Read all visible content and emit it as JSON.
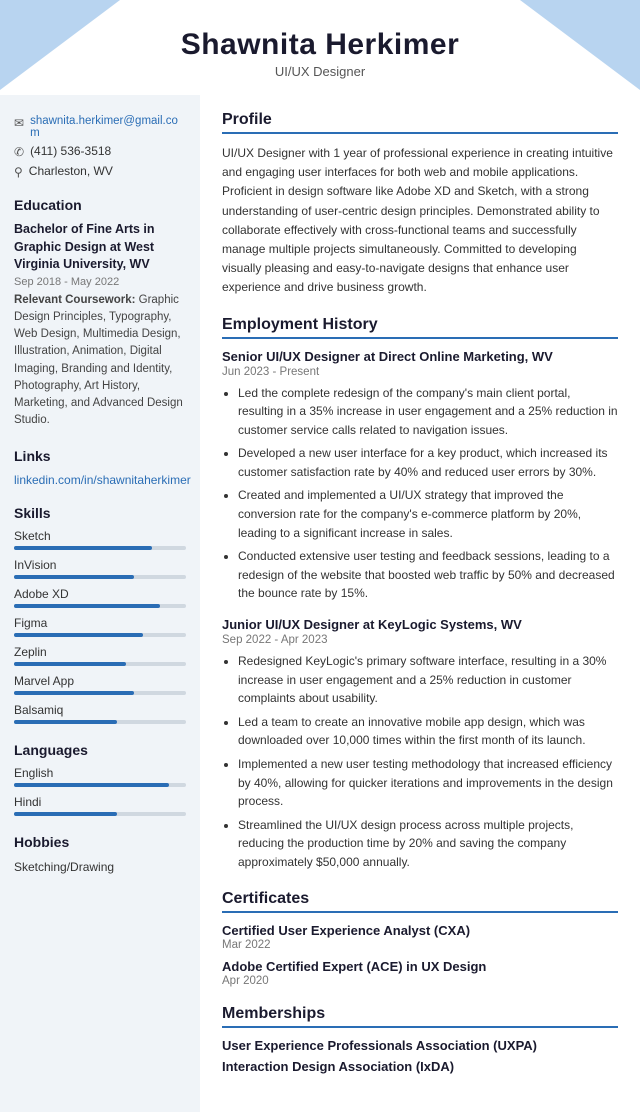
{
  "header": {
    "name": "Shawnita Herkimer",
    "title": "UI/UX Designer"
  },
  "sidebar": {
    "contact": {
      "email": "shawnita.herkimer@gmail.com",
      "phone": "(411) 536-3518",
      "location": "Charleston, WV"
    },
    "education": {
      "section_title": "Education",
      "degree": "Bachelor of Fine Arts in Graphic Design at West Virginia University, WV",
      "dates": "Sep 2018 - May 2022",
      "coursework_label": "Relevant Coursework:",
      "coursework": "Graphic Design Principles, Typography, Web Design, Multimedia Design, Illustration, Animation, Digital Imaging, Branding and Identity, Photography, Art History, Marketing, and Advanced Design Studio."
    },
    "links": {
      "section_title": "Links",
      "items": [
        {
          "label": "linkedin.com/in/shawnitaherkimer",
          "url": "#"
        }
      ]
    },
    "skills": {
      "section_title": "Skills",
      "items": [
        {
          "name": "Sketch",
          "percent": 80
        },
        {
          "name": "InVision",
          "percent": 70
        },
        {
          "name": "Adobe XD",
          "percent": 85
        },
        {
          "name": "Figma",
          "percent": 75
        },
        {
          "name": "Zeplin",
          "percent": 65
        },
        {
          "name": "Marvel App",
          "percent": 70
        },
        {
          "name": "Balsamiq",
          "percent": 60
        }
      ]
    },
    "languages": {
      "section_title": "Languages",
      "items": [
        {
          "name": "English",
          "percent": 90
        },
        {
          "name": "Hindi",
          "percent": 60
        }
      ]
    },
    "hobbies": {
      "section_title": "Hobbies",
      "text": "Sketching/Drawing"
    }
  },
  "main": {
    "profile": {
      "section_title": "Profile",
      "text": "UI/UX Designer with 1 year of professional experience in creating intuitive and engaging user interfaces for both web and mobile applications. Proficient in design software like Adobe XD and Sketch, with a strong understanding of user-centric design principles. Demonstrated ability to collaborate effectively with cross-functional teams and successfully manage multiple projects simultaneously. Committed to developing visually pleasing and easy-to-navigate designs that enhance user experience and drive business growth."
    },
    "employment": {
      "section_title": "Employment History",
      "jobs": [
        {
          "title": "Senior UI/UX Designer at Direct Online Marketing, WV",
          "dates": "Jun 2023 - Present",
          "bullets": [
            "Led the complete redesign of the company's main client portal, resulting in a 35% increase in user engagement and a 25% reduction in customer service calls related to navigation issues.",
            "Developed a new user interface for a key product, which increased its customer satisfaction rate by 40% and reduced user errors by 30%.",
            "Created and implemented a UI/UX strategy that improved the conversion rate for the company's e-commerce platform by 20%, leading to a significant increase in sales.",
            "Conducted extensive user testing and feedback sessions, leading to a redesign of the website that boosted web traffic by 50% and decreased the bounce rate by 15%."
          ]
        },
        {
          "title": "Junior UI/UX Designer at KeyLogic Systems, WV",
          "dates": "Sep 2022 - Apr 2023",
          "bullets": [
            "Redesigned KeyLogic's primary software interface, resulting in a 30% increase in user engagement and a 25% reduction in customer complaints about usability.",
            "Led a team to create an innovative mobile app design, which was downloaded over 10,000 times within the first month of its launch.",
            "Implemented a new user testing methodology that increased efficiency by 40%, allowing for quicker iterations and improvements in the design process.",
            "Streamlined the UI/UX design process across multiple projects, reducing the production time by 20% and saving the company approximately $50,000 annually."
          ]
        }
      ]
    },
    "certificates": {
      "section_title": "Certificates",
      "items": [
        {
          "title": "Certified User Experience Analyst (CXA)",
          "date": "Mar 2022"
        },
        {
          "title": "Adobe Certified Expert (ACE) in UX Design",
          "date": "Apr 2020"
        }
      ]
    },
    "memberships": {
      "section_title": "Memberships",
      "items": [
        {
          "title": "User Experience Professionals Association (UXPA)"
        },
        {
          "title": "Interaction Design Association (IxDA)"
        }
      ]
    }
  }
}
